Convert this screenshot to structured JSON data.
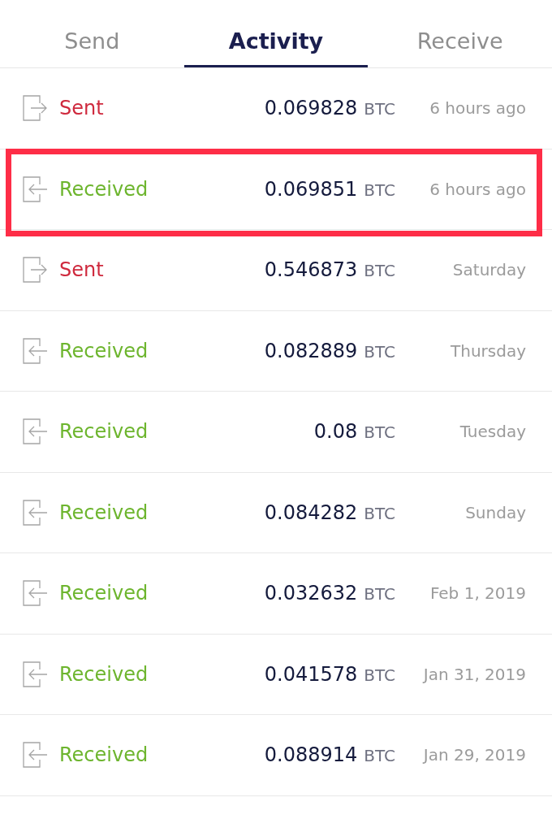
{
  "tabs": [
    {
      "label": "Send",
      "selected": false
    },
    {
      "label": "Activity",
      "selected": true
    },
    {
      "label": "Receive",
      "selected": false
    }
  ],
  "transactions": [
    {
      "kind": "sent",
      "label": "Sent",
      "amount": "0.069828",
      "unit": "BTC",
      "time": "6 hours ago",
      "highlighted": false
    },
    {
      "kind": "received",
      "label": "Received",
      "amount": "0.069851",
      "unit": "BTC",
      "time": "6 hours ago",
      "highlighted": true
    },
    {
      "kind": "sent",
      "label": "Sent",
      "amount": "0.546873",
      "unit": "BTC",
      "time": "Saturday",
      "highlighted": false
    },
    {
      "kind": "received",
      "label": "Received",
      "amount": "0.082889",
      "unit": "BTC",
      "time": "Thursday",
      "highlighted": false
    },
    {
      "kind": "received",
      "label": "Received",
      "amount": "0.08",
      "unit": "BTC",
      "time": "Tuesday",
      "highlighted": false
    },
    {
      "kind": "received",
      "label": "Received",
      "amount": "0.084282",
      "unit": "BTC",
      "time": "Sunday",
      "highlighted": false
    },
    {
      "kind": "received",
      "label": "Received",
      "amount": "0.032632",
      "unit": "BTC",
      "time": "Feb 1, 2019",
      "highlighted": false
    },
    {
      "kind": "received",
      "label": "Received",
      "amount": "0.041578",
      "unit": "BTC",
      "time": "Jan 31, 2019",
      "highlighted": false
    },
    {
      "kind": "received",
      "label": "Received",
      "amount": "0.088914",
      "unit": "BTC",
      "time": "Jan 29, 2019",
      "highlighted": false
    }
  ]
}
